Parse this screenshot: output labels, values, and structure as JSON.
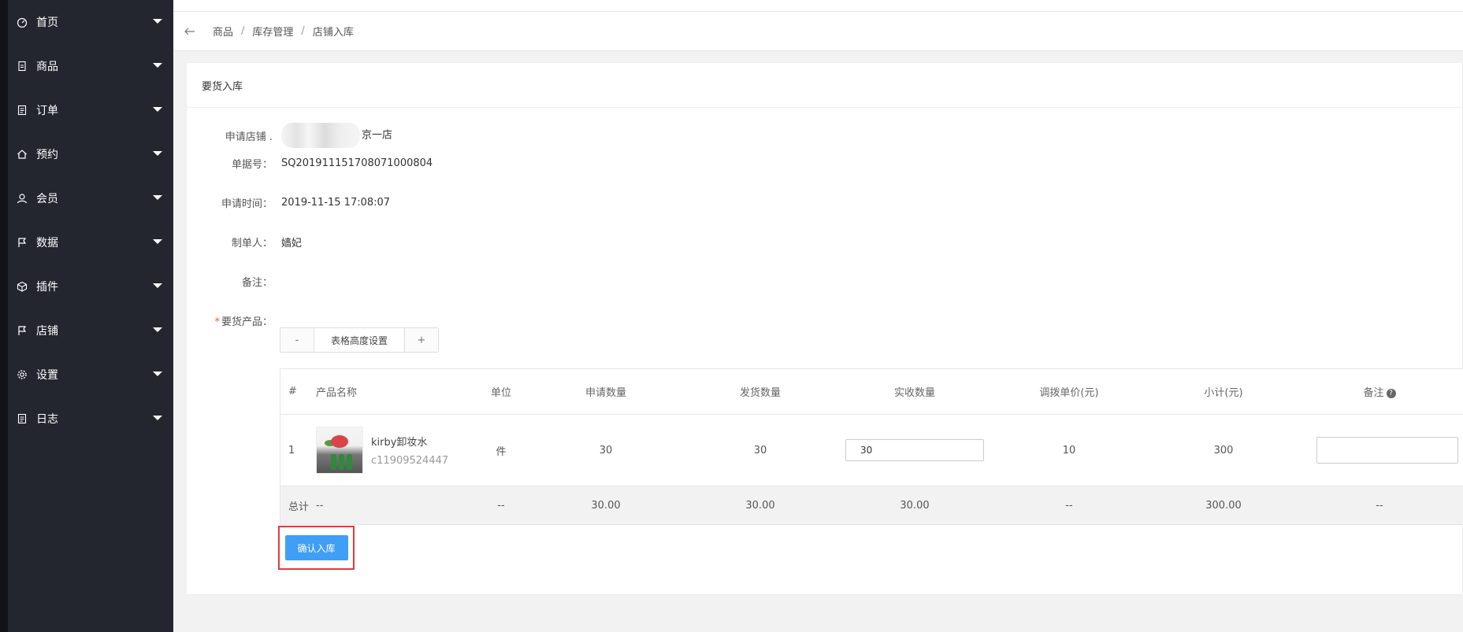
{
  "sidebar": {
    "items": [
      {
        "label": "首页",
        "icon": "dashboard-icon"
      },
      {
        "label": "商品",
        "icon": "document-icon"
      },
      {
        "label": "订单",
        "icon": "list-icon"
      },
      {
        "label": "预约",
        "icon": "home-icon"
      },
      {
        "label": "会员",
        "icon": "user-icon"
      },
      {
        "label": "数据",
        "icon": "flag-icon"
      },
      {
        "label": "插件",
        "icon": "cube-icon"
      },
      {
        "label": "店铺",
        "icon": "flag-icon"
      },
      {
        "label": "设置",
        "icon": "gear-icon"
      },
      {
        "label": "日志",
        "icon": "log-icon"
      }
    ]
  },
  "breadcrumb": [
    "商品",
    "库存管理",
    "店铺入库"
  ],
  "card": {
    "title": "要货入库",
    "fields": {
      "store_label": "申请店铺",
      "store_value": "京一店",
      "order_no_label": "单据号：",
      "order_no_value": "SQ201911151708071000804",
      "time_label": "申请时间：",
      "time_value": "2019-11-15 17:08:07",
      "maker_label": "制单人：",
      "maker_value": "嫱妃",
      "note_label": "备注：",
      "products_label": "要货产品："
    },
    "height_control": {
      "minus": "-",
      "label": "表格高度设置",
      "plus": "+"
    }
  },
  "table": {
    "headers": [
      "#",
      "产品名称",
      "单位",
      "申请数量",
      "发货数量",
      "实收数量",
      "调拨单价(元)",
      "小计(元)",
      "备注"
    ],
    "rows": [
      {
        "index": "1",
        "name": "kirby卸妆水",
        "code": "c11909524447",
        "unit": "件",
        "requested": "30",
        "shipped": "30",
        "received": "30",
        "price": "10",
        "subtotal": "300",
        "note": ""
      }
    ],
    "totals": {
      "label": "总计",
      "name": "--",
      "unit": "--",
      "requested": "30.00",
      "shipped": "30.00",
      "received": "30.00",
      "price": "--",
      "subtotal": "300.00",
      "note": "--"
    }
  },
  "confirm_button": "确认入库",
  "colors": {
    "sidebar_bg": "#23262e",
    "primary_button": "#3f9ef6",
    "highlight_border": "#e8383d",
    "required_mark": "#ff5722"
  }
}
